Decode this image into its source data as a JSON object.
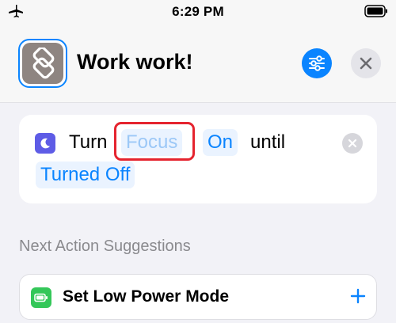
{
  "status_bar": {
    "time": "6:29 PM",
    "airplane_icon": "airplane-icon",
    "battery_icon": "battery-icon"
  },
  "header": {
    "title": "Work work!",
    "app_icon": "shortcuts-icon",
    "settings_icon": "sliders-icon",
    "close_icon": "close-icon"
  },
  "action": {
    "icon": "moon-icon",
    "verb": "Turn",
    "focus_placeholder": "Focus",
    "state_value": "On",
    "connector": "until",
    "until_value": "Turned Off",
    "remove_icon": "remove-icon"
  },
  "suggestions": {
    "title": "Next Action Suggestions",
    "items": [
      {
        "label": "Set Low Power Mode",
        "icon": "low-power-icon",
        "add_icon": "plus-icon"
      }
    ]
  },
  "colors": {
    "accent": "#0a84ff",
    "focus_purple": "#5e5ce6",
    "power_green": "#34c759",
    "highlight_red": "#e5242f"
  }
}
